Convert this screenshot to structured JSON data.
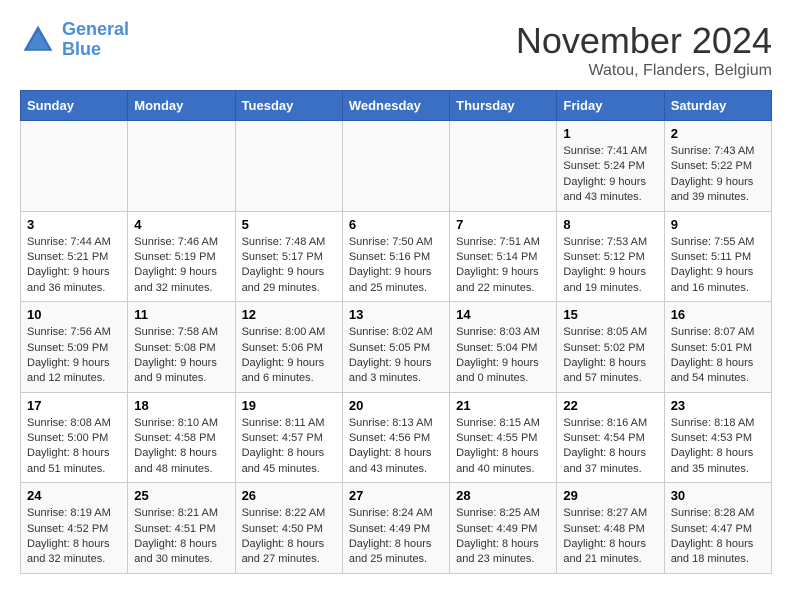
{
  "header": {
    "logo_line1": "General",
    "logo_line2": "Blue",
    "month_title": "November 2024",
    "location": "Watou, Flanders, Belgium"
  },
  "days_of_week": [
    "Sunday",
    "Monday",
    "Tuesday",
    "Wednesday",
    "Thursday",
    "Friday",
    "Saturday"
  ],
  "weeks": [
    [
      {
        "day": "",
        "info": ""
      },
      {
        "day": "",
        "info": ""
      },
      {
        "day": "",
        "info": ""
      },
      {
        "day": "",
        "info": ""
      },
      {
        "day": "",
        "info": ""
      },
      {
        "day": "1",
        "info": "Sunrise: 7:41 AM\nSunset: 5:24 PM\nDaylight: 9 hours and 43 minutes."
      },
      {
        "day": "2",
        "info": "Sunrise: 7:43 AM\nSunset: 5:22 PM\nDaylight: 9 hours and 39 minutes."
      }
    ],
    [
      {
        "day": "3",
        "info": "Sunrise: 7:44 AM\nSunset: 5:21 PM\nDaylight: 9 hours and 36 minutes."
      },
      {
        "day": "4",
        "info": "Sunrise: 7:46 AM\nSunset: 5:19 PM\nDaylight: 9 hours and 32 minutes."
      },
      {
        "day": "5",
        "info": "Sunrise: 7:48 AM\nSunset: 5:17 PM\nDaylight: 9 hours and 29 minutes."
      },
      {
        "day": "6",
        "info": "Sunrise: 7:50 AM\nSunset: 5:16 PM\nDaylight: 9 hours and 25 minutes."
      },
      {
        "day": "7",
        "info": "Sunrise: 7:51 AM\nSunset: 5:14 PM\nDaylight: 9 hours and 22 minutes."
      },
      {
        "day": "8",
        "info": "Sunrise: 7:53 AM\nSunset: 5:12 PM\nDaylight: 9 hours and 19 minutes."
      },
      {
        "day": "9",
        "info": "Sunrise: 7:55 AM\nSunset: 5:11 PM\nDaylight: 9 hours and 16 minutes."
      }
    ],
    [
      {
        "day": "10",
        "info": "Sunrise: 7:56 AM\nSunset: 5:09 PM\nDaylight: 9 hours and 12 minutes."
      },
      {
        "day": "11",
        "info": "Sunrise: 7:58 AM\nSunset: 5:08 PM\nDaylight: 9 hours and 9 minutes."
      },
      {
        "day": "12",
        "info": "Sunrise: 8:00 AM\nSunset: 5:06 PM\nDaylight: 9 hours and 6 minutes."
      },
      {
        "day": "13",
        "info": "Sunrise: 8:02 AM\nSunset: 5:05 PM\nDaylight: 9 hours and 3 minutes."
      },
      {
        "day": "14",
        "info": "Sunrise: 8:03 AM\nSunset: 5:04 PM\nDaylight: 9 hours and 0 minutes."
      },
      {
        "day": "15",
        "info": "Sunrise: 8:05 AM\nSunset: 5:02 PM\nDaylight: 8 hours and 57 minutes."
      },
      {
        "day": "16",
        "info": "Sunrise: 8:07 AM\nSunset: 5:01 PM\nDaylight: 8 hours and 54 minutes."
      }
    ],
    [
      {
        "day": "17",
        "info": "Sunrise: 8:08 AM\nSunset: 5:00 PM\nDaylight: 8 hours and 51 minutes."
      },
      {
        "day": "18",
        "info": "Sunrise: 8:10 AM\nSunset: 4:58 PM\nDaylight: 8 hours and 48 minutes."
      },
      {
        "day": "19",
        "info": "Sunrise: 8:11 AM\nSunset: 4:57 PM\nDaylight: 8 hours and 45 minutes."
      },
      {
        "day": "20",
        "info": "Sunrise: 8:13 AM\nSunset: 4:56 PM\nDaylight: 8 hours and 43 minutes."
      },
      {
        "day": "21",
        "info": "Sunrise: 8:15 AM\nSunset: 4:55 PM\nDaylight: 8 hours and 40 minutes."
      },
      {
        "day": "22",
        "info": "Sunrise: 8:16 AM\nSunset: 4:54 PM\nDaylight: 8 hours and 37 minutes."
      },
      {
        "day": "23",
        "info": "Sunrise: 8:18 AM\nSunset: 4:53 PM\nDaylight: 8 hours and 35 minutes."
      }
    ],
    [
      {
        "day": "24",
        "info": "Sunrise: 8:19 AM\nSunset: 4:52 PM\nDaylight: 8 hours and 32 minutes."
      },
      {
        "day": "25",
        "info": "Sunrise: 8:21 AM\nSunset: 4:51 PM\nDaylight: 8 hours and 30 minutes."
      },
      {
        "day": "26",
        "info": "Sunrise: 8:22 AM\nSunset: 4:50 PM\nDaylight: 8 hours and 27 minutes."
      },
      {
        "day": "27",
        "info": "Sunrise: 8:24 AM\nSunset: 4:49 PM\nDaylight: 8 hours and 25 minutes."
      },
      {
        "day": "28",
        "info": "Sunrise: 8:25 AM\nSunset: 4:49 PM\nDaylight: 8 hours and 23 minutes."
      },
      {
        "day": "29",
        "info": "Sunrise: 8:27 AM\nSunset: 4:48 PM\nDaylight: 8 hours and 21 minutes."
      },
      {
        "day": "30",
        "info": "Sunrise: 8:28 AM\nSunset: 4:47 PM\nDaylight: 8 hours and 18 minutes."
      }
    ]
  ]
}
